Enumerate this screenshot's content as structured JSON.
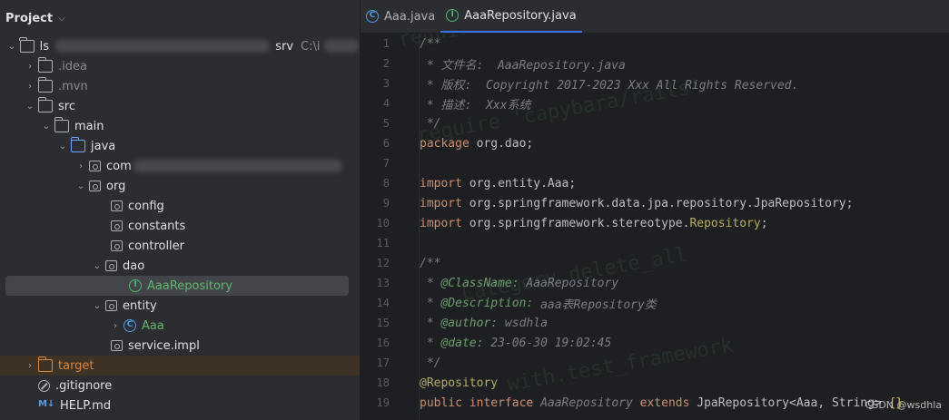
{
  "project_panel": {
    "title": "Project",
    "root": {
      "name_start": "ls",
      "name_end": "srv",
      "path": "C:\\i"
    },
    "items": [
      {
        "label": ".idea"
      },
      {
        "label": ".mvn"
      },
      {
        "label": "src"
      },
      {
        "label": "main"
      },
      {
        "label": "java"
      },
      {
        "label": "com"
      },
      {
        "label": "org"
      },
      {
        "label": "config"
      },
      {
        "label": "constants"
      },
      {
        "label": "controller"
      },
      {
        "label": "dao"
      },
      {
        "label": "AaaRepository"
      },
      {
        "label": "entity"
      },
      {
        "label": "Aaa"
      },
      {
        "label": "service.impl"
      },
      {
        "label": "target"
      },
      {
        "label": ".gitignore"
      },
      {
        "label": "HELP.md"
      }
    ],
    "md_badge": "M↓"
  },
  "tabs": [
    {
      "label": "Aaa.java",
      "icon": "class-icon",
      "icon_glyph": "C"
    },
    {
      "label": "AaaRepository.java",
      "icon": "interface-icon",
      "icon_glyph": "I"
    }
  ],
  "editor": {
    "lines": [
      {
        "n": "1",
        "parts": [
          {
            "t": "/**",
            "c": "com"
          }
        ]
      },
      {
        "n": "2",
        "parts": [
          {
            "t": " * 文件名:  AaaRepository.java",
            "c": "com"
          }
        ]
      },
      {
        "n": "3",
        "parts": [
          {
            "t": " * 版权:  Copyright 2017-2023 Xxx All Rights Reserved.",
            "c": "com"
          }
        ]
      },
      {
        "n": "4",
        "parts": [
          {
            "t": " * 描述:  Xxx系统",
            "c": "com"
          }
        ]
      },
      {
        "n": "5",
        "parts": [
          {
            "t": " */",
            "c": "com"
          }
        ]
      },
      {
        "n": "6",
        "parts": [
          {
            "t": "package ",
            "c": "kw"
          },
          {
            "t": "org.dao;",
            "c": "txt"
          }
        ]
      },
      {
        "n": "7",
        "parts": []
      },
      {
        "n": "8",
        "parts": [
          {
            "t": "import ",
            "c": "kw"
          },
          {
            "t": "org.entity.Aaa;",
            "c": "txt"
          }
        ]
      },
      {
        "n": "9",
        "parts": [
          {
            "t": "import ",
            "c": "kw"
          },
          {
            "t": "org.springframework.data.jpa.repository.JpaRepository;",
            "c": "txt"
          }
        ]
      },
      {
        "n": "10",
        "parts": [
          {
            "t": "import ",
            "c": "kw"
          },
          {
            "t": "org.springframework.stereotype.",
            "c": "txt"
          },
          {
            "t": "Repository",
            "c": "ann"
          },
          {
            "t": ";",
            "c": "txt"
          }
        ]
      },
      {
        "n": "11",
        "parts": []
      },
      {
        "n": "12",
        "parts": [
          {
            "t": "/**",
            "c": "com"
          }
        ]
      },
      {
        "n": "13",
        "parts": [
          {
            "t": " * ",
            "c": "com"
          },
          {
            "t": "@ClassName:",
            "c": "tag"
          },
          {
            "t": " AaaRepository",
            "c": "tagv"
          }
        ]
      },
      {
        "n": "14",
        "parts": [
          {
            "t": " * ",
            "c": "com"
          },
          {
            "t": "@Description:",
            "c": "tag"
          },
          {
            "t": " aaa表Repository类",
            "c": "tagv"
          }
        ]
      },
      {
        "n": "15",
        "parts": [
          {
            "t": " * ",
            "c": "com"
          },
          {
            "t": "@author:",
            "c": "tag"
          },
          {
            "t": " wsdhla",
            "c": "tagv"
          }
        ]
      },
      {
        "n": "16",
        "parts": [
          {
            "t": " * ",
            "c": "com"
          },
          {
            "t": "@date:",
            "c": "tag"
          },
          {
            "t": " 23-06-30 19:02:45",
            "c": "tagv"
          }
        ]
      },
      {
        "n": "17",
        "parts": [
          {
            "t": " */",
            "c": "com"
          }
        ]
      },
      {
        "n": "18",
        "parts": [
          {
            "t": "@Repository",
            "c": "ann"
          }
        ]
      },
      {
        "n": "19",
        "parts": [
          {
            "t": "public interface ",
            "c": "kw"
          },
          {
            "t": "AaaRepository ",
            "c": "com"
          },
          {
            "t": "extends ",
            "c": "kw"
          },
          {
            "t": "JpaRepository<Aaa, String> ",
            "c": "txt"
          },
          {
            "t": "{}",
            "c": "brace"
          }
        ]
      }
    ]
  },
  "watermark": "CSDN @wsdhla",
  "colors": {
    "accent": "#3574f0",
    "selection": "#43454a",
    "target_bg": "#3d3223"
  }
}
